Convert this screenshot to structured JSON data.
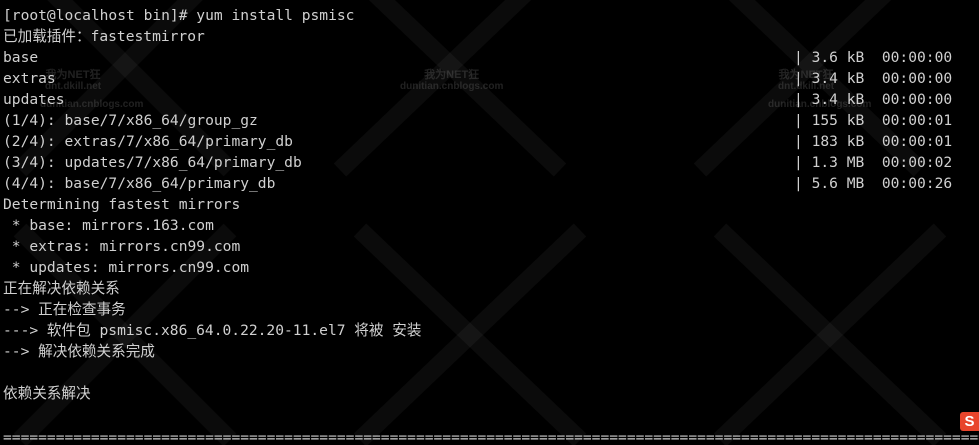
{
  "prompt_line": "[root@localhost bin]# yum install psmisc",
  "plugins_line": "已加载插件：fastestmirror",
  "repo_rows": [
    {
      "name": "base",
      "stats": "| 3.6 kB  00:00:00"
    },
    {
      "name": "extras",
      "stats": "| 3.4 kB  00:00:00"
    },
    {
      "name": "updates",
      "stats": "| 3.4 kB  00:00:00"
    },
    {
      "name": "(1/4): base/7/x86_64/group_gz",
      "stats": "| 155 kB  00:00:01"
    },
    {
      "name": "(2/4): extras/7/x86_64/primary_db",
      "stats": "| 183 kB  00:00:01"
    },
    {
      "name": "(3/4): updates/7/x86_64/primary_db",
      "stats": "| 1.3 MB  00:00:02"
    },
    {
      "name": "(4/4): base/7/x86_64/primary_db",
      "stats": "| 5.6 MB  00:00:26"
    }
  ],
  "mirror_lines": [
    "Determining fastest mirrors",
    " * base: mirrors.163.com",
    " * extras: mirrors.cn99.com",
    " * updates: mirrors.cn99.com"
  ],
  "resolve_lines": [
    "正在解决依赖关系",
    "--> 正在检查事务",
    "---> 软件包 psmisc.x86_64.0.22.20-11.el7 将被 安装",
    "--> 解决依赖关系完成"
  ],
  "blank_line": "",
  "resolved_line": "依赖关系解决",
  "separator": "=========================================================================================================================",
  "watermarks": [
    {
      "cn": "我为NET狂",
      "url": "dnt.dkill.net"
    },
    {
      "cn": "我为NET狂",
      "url": "dunitian.cnblogs.com"
    },
    {
      "cn": "我为NET狂",
      "url": "dnt.dkill.net"
    },
    {
      "cn": "",
      "url": "dunitian.cnblogs.com"
    },
    {
      "cn": "",
      "url": "dunitian.cnblogs.com"
    }
  ],
  "sohu_logo": "S",
  "colors": {
    "background": "#000000",
    "text": "#d0d0d0",
    "watermark": "rgba(255,255,255,0.13)",
    "logo": "#e8452c"
  }
}
